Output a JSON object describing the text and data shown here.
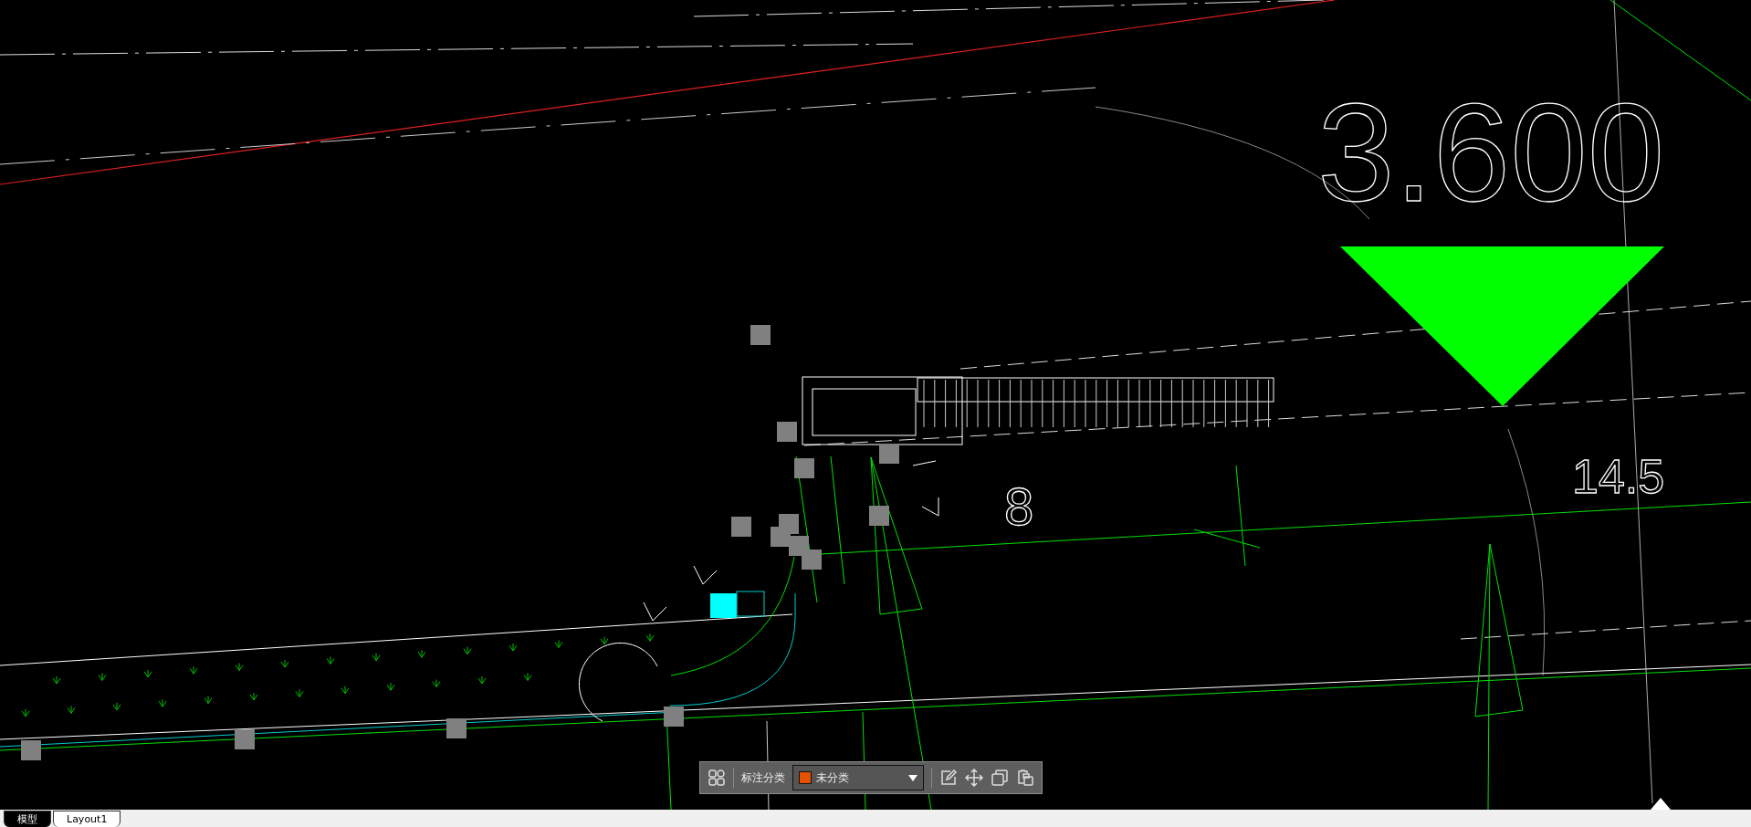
{
  "canvas": {
    "elevation_label": "3.600",
    "dimension_labels": [
      "14.5",
      "8"
    ]
  },
  "annotation_toolbar": {
    "label": "标注分类",
    "category": "未分类"
  },
  "layout_tabs": [
    {
      "label": "模型",
      "selected": true
    },
    {
      "label": "Layout1",
      "selected": false
    }
  ]
}
